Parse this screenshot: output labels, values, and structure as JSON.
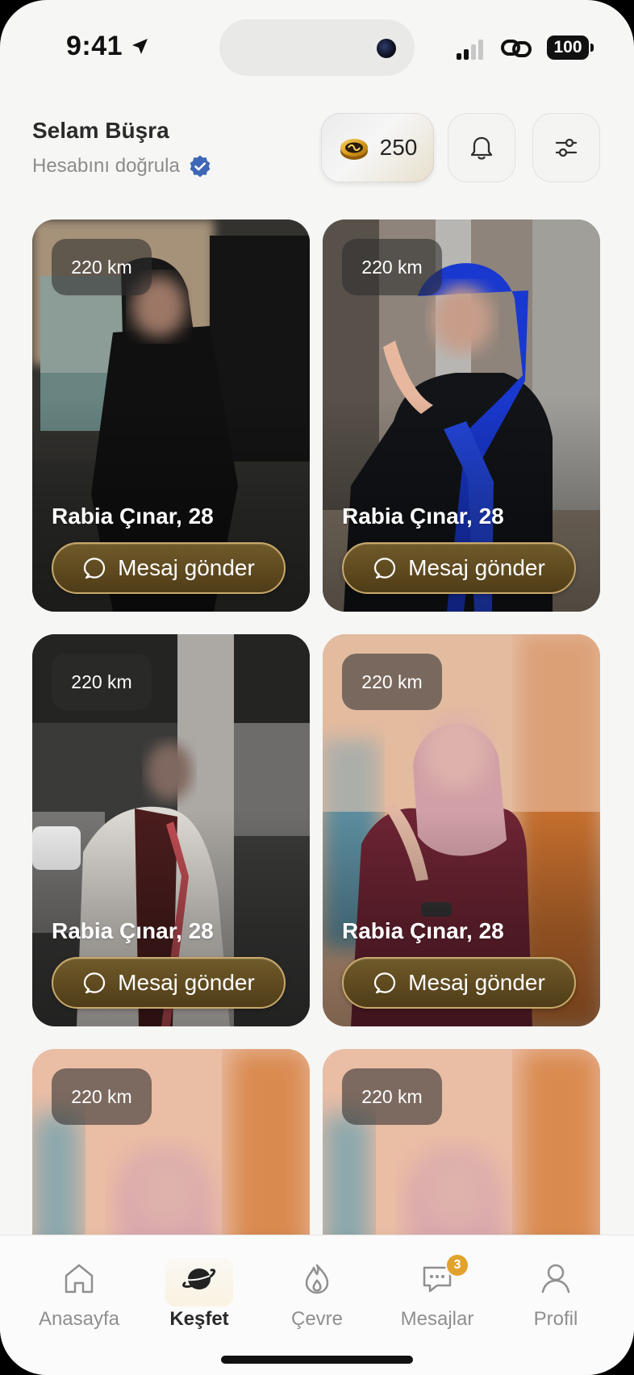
{
  "status_bar": {
    "time": "9:41",
    "battery": "100"
  },
  "header": {
    "greeting": "Selam Büşra",
    "verify_text": "Hesabını doğrula",
    "coins": "250"
  },
  "cards": [
    {
      "distance": "220 km",
      "name": "Rabia Çınar, 28",
      "button_label": "Mesaj gönder"
    },
    {
      "distance": "220 km",
      "name": "Rabia Çınar, 28",
      "button_label": "Mesaj gönder"
    },
    {
      "distance": "220 km",
      "name": "Rabia Çınar, 28",
      "button_label": "Mesaj gönder"
    },
    {
      "distance": "220 km",
      "name": "Rabia Çınar, 28",
      "button_label": "Mesaj gönder"
    },
    {
      "distance": "220 km"
    },
    {
      "distance": "220 km"
    }
  ],
  "tabs": [
    {
      "label": "Anasayfa",
      "icon": "home-icon"
    },
    {
      "label": "Keşfet",
      "icon": "planet-icon",
      "active": true
    },
    {
      "label": "Çevre",
      "icon": "flame-icon"
    },
    {
      "label": "Mesajlar",
      "icon": "chat-icon",
      "badge": "3"
    },
    {
      "label": "Profil",
      "icon": "profile-icon"
    }
  ],
  "colors": {
    "accent_gold": "#c9a96a",
    "button_brown": "#5f4a20",
    "verified_blue": "#3e67b5",
    "badge_orange": "#e1a32d"
  }
}
